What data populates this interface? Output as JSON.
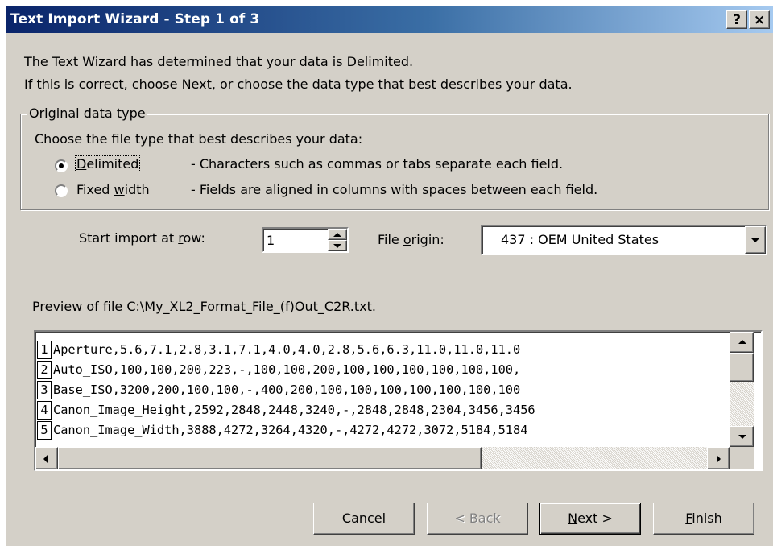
{
  "window": {
    "title": "Text Import Wizard - Step 1 of 3",
    "help_glyph": "?",
    "close_glyph": "×"
  },
  "intro": {
    "line1": "The Text Wizard has determined that your data is Delimited.",
    "line2": "If this is correct, choose Next, or choose the data type that best describes your data."
  },
  "group": {
    "legend": "Original data type",
    "prompt": "Choose the file type that best describes your data:",
    "options": [
      {
        "label_pre": "",
        "label_accel": "D",
        "label_post": "elimited",
        "desc": "- Characters such as commas or tabs separate each field.",
        "selected": true
      },
      {
        "label_pre": "Fixed ",
        "label_accel": "w",
        "label_post": "idth",
        "desc": "- Fields are aligned in columns with spaces between each field.",
        "selected": false
      }
    ]
  },
  "start_row": {
    "label_pre": "Start import at ",
    "label_accel": "r",
    "label_post": "ow:",
    "value": "1"
  },
  "file_origin": {
    "label_pre": "File ",
    "label_accel": "o",
    "label_post": "rigin:",
    "value": "437 : OEM United States"
  },
  "preview": {
    "label": "Preview of file C:\\My_XL2_Format_File_(f)Out_C2R.txt.",
    "lines": [
      {
        "num": "1",
        "text": "Aperture,5.6,7.1,2.8,3.1,7.1,4.0,4.0,2.8,5.6,6.3,11.0,11.0,11.0"
      },
      {
        "num": "2",
        "text": "Auto_ISO,100,100,200,223,-,100,100,200,100,100,100,100,100,100,"
      },
      {
        "num": "3",
        "text": "Base_ISO,3200,200,100,100,-,400,200,100,100,100,100,100,100,100"
      },
      {
        "num": "4",
        "text": "Canon_Image_Height,2592,2848,2448,3240,-,2848,2848,2304,3456,3456"
      },
      {
        "num": "5",
        "text": "Canon_Image_Width,3888,4272,3264,4320,-,4272,4272,3072,5184,5184"
      }
    ]
  },
  "buttons": {
    "cancel": "Cancel",
    "back": "< Back",
    "next_accel": "N",
    "next_post": "ext >",
    "finish_accel": "F",
    "finish_post": "inish"
  }
}
